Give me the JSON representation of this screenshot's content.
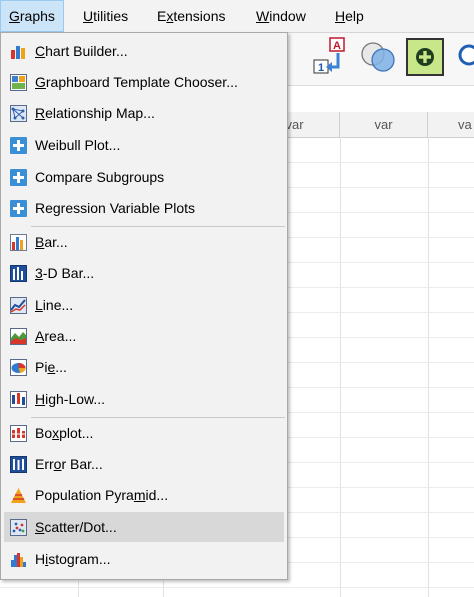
{
  "menubar": {
    "items": [
      {
        "label": "Graphs",
        "accel": "G",
        "rest": "raphs"
      },
      {
        "label": "Utilities",
        "accel": "U",
        "rest": "tilities"
      },
      {
        "label": "Extensions",
        "accel": "x",
        "pre": "E",
        "rest": "tensions"
      },
      {
        "label": "Window",
        "accel": "W",
        "rest": "indow"
      },
      {
        "label": "Help",
        "accel": "H",
        "rest": "elp"
      }
    ]
  },
  "toolbar": {
    "insert_cases_icon_text_a": "A",
    "insert_cases_icon_text_1": "1"
  },
  "grid": {
    "columns": [
      "var",
      "var",
      "va"
    ]
  },
  "graphs_menu": {
    "items": [
      {
        "pre": "",
        "accel": "C",
        "rest": "hart Builder...",
        "icon": "chart-builder-icon"
      },
      {
        "pre": "",
        "accel": "G",
        "rest": "raphboard Template Chooser...",
        "icon": "graphboard-icon"
      },
      {
        "pre": "",
        "accel": "R",
        "rest": "elationship Map...",
        "icon": "relationship-map-icon"
      },
      {
        "pre": "Weibull Plot...",
        "accel": "",
        "rest": "",
        "icon": "plus-icon"
      },
      {
        "pre": "Compare Subgroups",
        "accel": "",
        "rest": "",
        "icon": "plus-icon"
      },
      {
        "pre": "Regression Variable Plots",
        "accel": "",
        "rest": "",
        "icon": "plus-icon"
      },
      {
        "pre": "",
        "accel": "B",
        "rest": "ar...",
        "icon": "bar-chart-icon"
      },
      {
        "pre": "",
        "accel": "3",
        "rest": "-D Bar...",
        "icon": "3d-bar-chart-icon"
      },
      {
        "pre": "",
        "accel": "L",
        "rest": "ine...",
        "icon": "line-chart-icon"
      },
      {
        "pre": "",
        "accel": "A",
        "rest": "rea...",
        "icon": "area-chart-icon"
      },
      {
        "pre": "Pi",
        "accel": "e",
        "rest": "...",
        "icon": "pie-chart-icon"
      },
      {
        "pre": "",
        "accel": "H",
        "rest": "igh-Low...",
        "icon": "high-low-chart-icon"
      },
      {
        "pre": "Bo",
        "accel": "x",
        "rest": "plot...",
        "icon": "boxplot-icon"
      },
      {
        "pre": "Err",
        "accel": "o",
        "rest": "r Bar...",
        "icon": "error-bar-icon"
      },
      {
        "pre": "Population Pyra",
        "accel": "m",
        "rest": "id...",
        "icon": "population-pyramid-icon"
      },
      {
        "pre": "",
        "accel": "S",
        "rest": "catter/Dot...",
        "icon": "scatter-dot-icon"
      },
      {
        "pre": "H",
        "accel": "i",
        "rest": "stogram...",
        "icon": "histogram-icon"
      }
    ]
  }
}
